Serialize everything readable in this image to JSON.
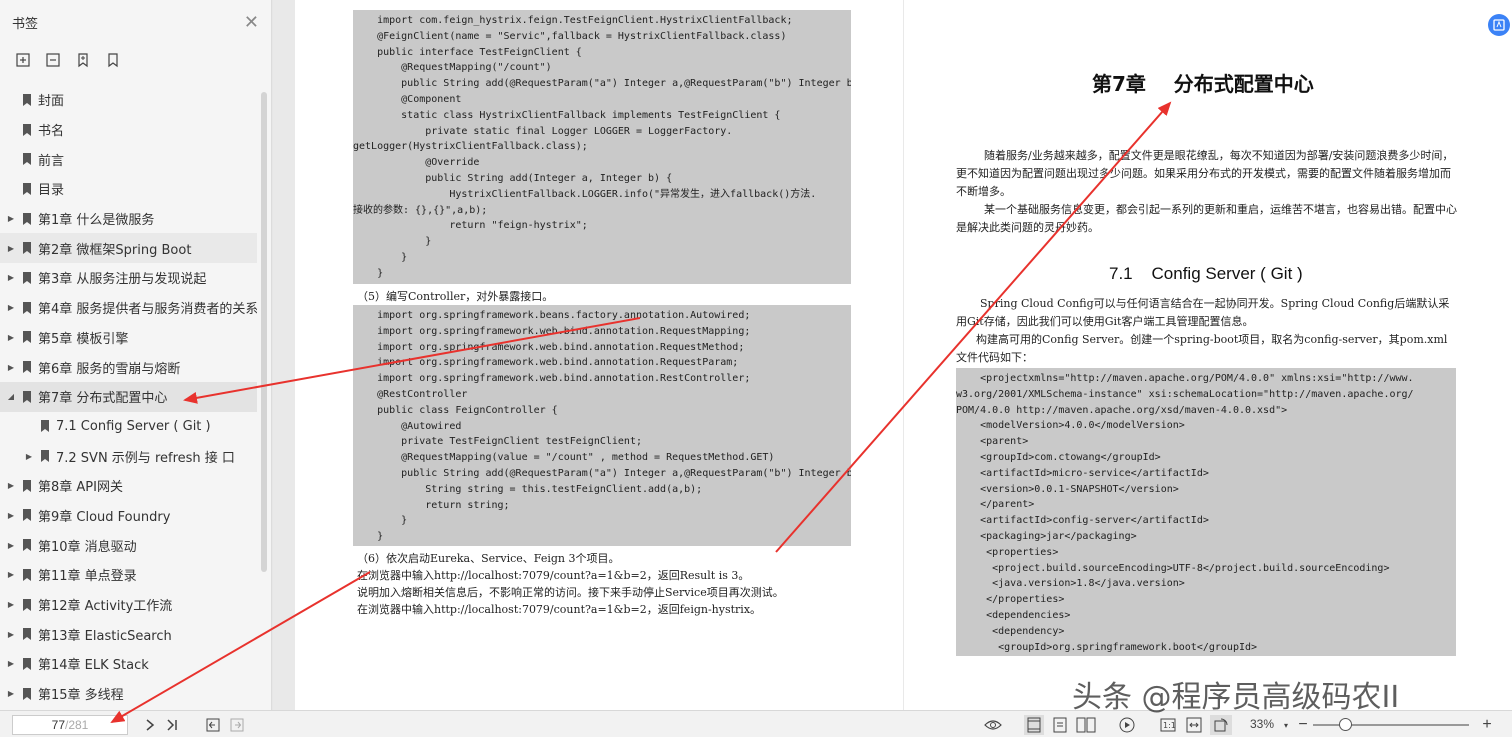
{
  "sidebar": {
    "title": "书签",
    "close_icon": "close-icon",
    "tools": [
      "expand-all-icon",
      "collapse-all-icon",
      "add-bookmark-icon",
      "bookmark-icon"
    ],
    "items": [
      {
        "label": "封面",
        "level": 0,
        "arrow": ""
      },
      {
        "label": "书名",
        "level": 0,
        "arrow": ""
      },
      {
        "label": "前言",
        "level": 0,
        "arrow": ""
      },
      {
        "label": "目录",
        "level": 0,
        "arrow": ""
      },
      {
        "label": "第1章 什么是微服务",
        "level": 0,
        "arrow": "▶"
      },
      {
        "label": "第2章 微框架Spring Boot",
        "level": 0,
        "arrow": "▶"
      },
      {
        "label": "第3章 从服务注册与发现说起",
        "level": 0,
        "arrow": "▶"
      },
      {
        "label": "第4章 服务提供者与服务消费者的关系",
        "level": 0,
        "arrow": "▶"
      },
      {
        "label": "第5章 模板引擎",
        "level": 0,
        "arrow": "▶"
      },
      {
        "label": "第6章 服务的雪崩与熔断",
        "level": 0,
        "arrow": "▶"
      },
      {
        "label": "第7章 分布式配置中心",
        "level": 0,
        "arrow": "◢"
      },
      {
        "label": "7.1 Config Server ( Git )",
        "level": 1,
        "arrow": ""
      },
      {
        "label": "7.2 SVN 示例与 refresh 接 口",
        "level": 1,
        "arrow": "▶"
      },
      {
        "label": "第8章 API网关",
        "level": 0,
        "arrow": "▶"
      },
      {
        "label": "第9章 Cloud Foundry",
        "level": 0,
        "arrow": "▶"
      },
      {
        "label": "第10章 消息驱动",
        "level": 0,
        "arrow": "▶"
      },
      {
        "label": "第11章 单点登录",
        "level": 0,
        "arrow": "▶"
      },
      {
        "label": "第12章 Activity工作流",
        "level": 0,
        "arrow": "▶"
      },
      {
        "label": "第13章 ElasticSearch",
        "level": 0,
        "arrow": "▶"
      },
      {
        "label": "第14章 ELK Stack",
        "level": 0,
        "arrow": "▶"
      },
      {
        "label": "第15章 多线程",
        "level": 0,
        "arrow": "▶"
      }
    ]
  },
  "left_page": {
    "code1": [
      "    import com.feign_hystrix.feign.TestFeignClient.HystrixClientFallback;",
      "    @FeignClient(name = \"Servic\",fallback = HystrixClientFallback.class)",
      "    public interface TestFeignClient {",
      "        @RequestMapping(\"/count\")",
      "        public String add(@RequestParam(\"a\") Integer a,@RequestParam(\"b\") Integer b);",
      "        @Component",
      "        static class HystrixClientFallback implements TestFeignClient {",
      "            private static final Logger LOGGER = LoggerFactory.",
      "getLogger(HystrixClientFallback.class);",
      "            @Override",
      "            public String add(Integer a, Integer b) {",
      "                HystrixClientFallback.LOGGER.info(\"异常发生，进入fallback()方法.",
      "接收的参数: {},{}\",a,b);",
      "                return \"feign-hystrix\";",
      "            }",
      "        }",
      "    }"
    ],
    "step5": "（5）编写Controller，对外暴露接口。",
    "code2": [
      "    import org.springframework.beans.factory.annotation.Autowired;",
      "    import org.springframework.web.bind.annotation.RequestMapping;",
      "    import org.springframework.web.bind.annotation.RequestMethod;",
      "    import org.springframework.web.bind.annotation.RequestParam;",
      "    import org.springframework.web.bind.annotation.RestController;",
      "    @RestController",
      "    public class FeignController {",
      "        @Autowired",
      "        private TestFeignClient testFeignClient;",
      "        @RequestMapping(value = \"/count\" , method = RequestMethod.GET)",
      "        public String add(@RequestParam(\"a\") Integer a,@RequestParam(\"b\") Integer b) {",
      "            String string = this.testFeignClient.add(a,b);",
      "            return string;",
      "        }",
      "    }"
    ],
    "step6": [
      "（6）依次启动Eureka、Service、Feign 3个项目。",
      "在浏览器中输入http://localhost:7079/count?a=1&b=2，返回Result is 3。",
      "说明加入熔断相关信息后，不影响正常的访问。接下来手动停止Service项目再次测试。",
      "在浏览器中输入http://localhost:7079/count?a=1&b=2，返回feign-hystrix。"
    ]
  },
  "right_page": {
    "chapter_title": "第7章    分布式配置中心",
    "intro_p1": "随着服务/业务越来越多，配置文件更是眼花缭乱，每次不知道因为部署/安装问题浪费多少时间，更不知道因为配置问题出现过多少问题。如果采用分布式的开发模式，需要的配置文件随着服务增加而不断增多。",
    "intro_p2": "某一个基础服务信息变更，都会引起一系列的更新和重启，运维苦不堪言，也容易出错。配置中心是解决此类问题的灵丹妙药。",
    "section_title": "7.1    Config Server ( Git )",
    "sec_p1": "Spring Cloud Config可以与任何语言结合在一起协同开发。Spring Cloud Config后端默认采用Git存储，因此我们可以使用Git客户端工具管理配置信息。",
    "sec_p2": "构建高可用的Config Server。创建一个spring-boot项目，取名为config-server，其pom.xml文件代码如下：",
    "code3": [
      "    <projectxmlns=\"http://maven.apache.org/POM/4.0.0\" xmlns:xsi=\"http://www.",
      "w3.org/2001/XMLSchema-instance\" xsi:schemaLocation=\"http://maven.apache.org/",
      "POM/4.0.0 http://maven.apache.org/xsd/maven-4.0.0.xsd\">",
      "    <modelVersion>4.0.0</modelVersion>",
      "    <parent>",
      "    <groupId>com.ctowang</groupId>",
      "    <artifactId>micro-service</artifactId>",
      "    <version>0.0.1-SNAPSHOT</version>",
      "    </parent>",
      "    <artifactId>config-server</artifactId>",
      "    <packaging>jar</packaging>",
      "     <properties>",
      "      <project.build.sourceEncoding>UTF-8</project.build.sourceEncoding>",
      "      <java.version>1.8</java.version>",
      "     </properties>",
      "     <dependencies>",
      "      <dependency>",
      "       <groupId>org.springframework.boot</groupId>"
    ]
  },
  "bottombar": {
    "current_page": "77",
    "total_pages": "/281",
    "zoom": "33%",
    "zoom_level_percent": 33
  },
  "watermark": "头条 @程序员高级码农II",
  "colors": {
    "arrow": "#e8322d",
    "accent": "#3b82f6"
  }
}
